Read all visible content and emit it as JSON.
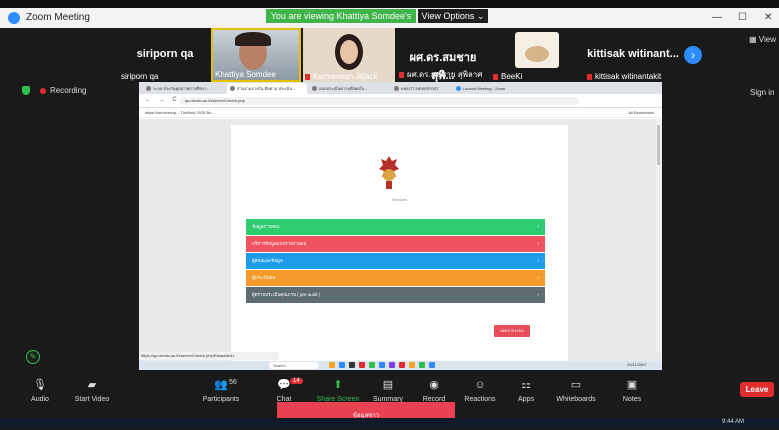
{
  "window": {
    "title": "Zoom Meeting"
  },
  "banner": {
    "viewing": "You are viewing Khattiya Somdee's screen",
    "view_options": "View Options  ⌄"
  },
  "window_controls": {
    "minimize": "—",
    "maximize": "☐",
    "close": "✕"
  },
  "gallery": {
    "tiles": [
      {
        "display_name": "siriporn qa",
        "label": "siriporn qa"
      },
      {
        "display_name": "",
        "label": "Khattiya Somdee"
      },
      {
        "display_name": "",
        "label": "Kamonwan Jitjack"
      },
      {
        "display_name": "ผศ.ดร.สมชาย สุพิ...",
        "label": "ผศ.ดร.สมชาย สุพิลาศ"
      },
      {
        "display_name": "",
        "label": "BeeKi"
      },
      {
        "display_name": "kittisak witinant...",
        "label": "kittisak witinantakit"
      }
    ],
    "next_icon": "chevron-right-icon",
    "view_label": "View"
  },
  "recording": {
    "label": "Recording",
    "sign_in": "Sign in"
  },
  "browser": {
    "tabs": [
      "ระบบ ประกันคุณภาพการศึกษา...",
      "ส่วนงานภายใน-ติดตาม ประเมิน...",
      "แบบประเมินความพึงพอใจ...",
      "KMUTT-NEWSPOST",
      "Launch Meeting - Zoom"
    ],
    "nav": "← → C",
    "url": "qa.rmutto.ac.th/server/Centre.php",
    "bookmarks": "https://servicesup...    TheBold 2025 Bo...",
    "reading_list": "All Bookmarks",
    "subtitle": "Services",
    "bars": [
      {
        "label": "ข้อมูลการสอบ",
        "color": "#2ecc71"
      },
      {
        "label": "บริหารข้อมูลแบบรายงานผล",
        "color": "#ef5360"
      },
      {
        "label": "ผู้สอนและข้อมูล",
        "color": "#1e9be9"
      },
      {
        "label": "ผู้ประเมินผล",
        "color": "#f39a2b"
      },
      {
        "label": "ผู้ตรวจประเมินคุณภาพ ( pre audit )",
        "color": "#5d6b73"
      }
    ],
    "submit_label": "ออกจากระบบ",
    "status_url": "https://qa.rmutto.ac.th/server/Centre.php/Risassim41",
    "taskbar_search": "Search",
    "taskbar_clock": "20/11/2567"
  },
  "controls": [
    {
      "label": "Audio",
      "icon": "mic-muted-icon"
    },
    {
      "label": "Start Video",
      "icon": "video-off-icon"
    },
    {
      "label": "Participants",
      "icon": "participants-icon",
      "count": "56"
    },
    {
      "label": "Chat",
      "icon": "chat-icon",
      "count": "14"
    },
    {
      "label": "Share Screen",
      "icon": "share-screen-icon"
    },
    {
      "label": "Summary",
      "icon": "summary-icon"
    },
    {
      "label": "Record",
      "icon": "record-icon"
    },
    {
      "label": "Reactions",
      "icon": "reactions-icon"
    },
    {
      "label": "Apps",
      "icon": "apps-icon"
    },
    {
      "label": "Whiteboards",
      "icon": "whiteboard-icon"
    },
    {
      "label": "Notes",
      "icon": "notes-icon"
    }
  ],
  "leave_label": "Leave",
  "bottom_overlay": "ข้อมูลข่าว",
  "clock": "9:44 AM"
}
